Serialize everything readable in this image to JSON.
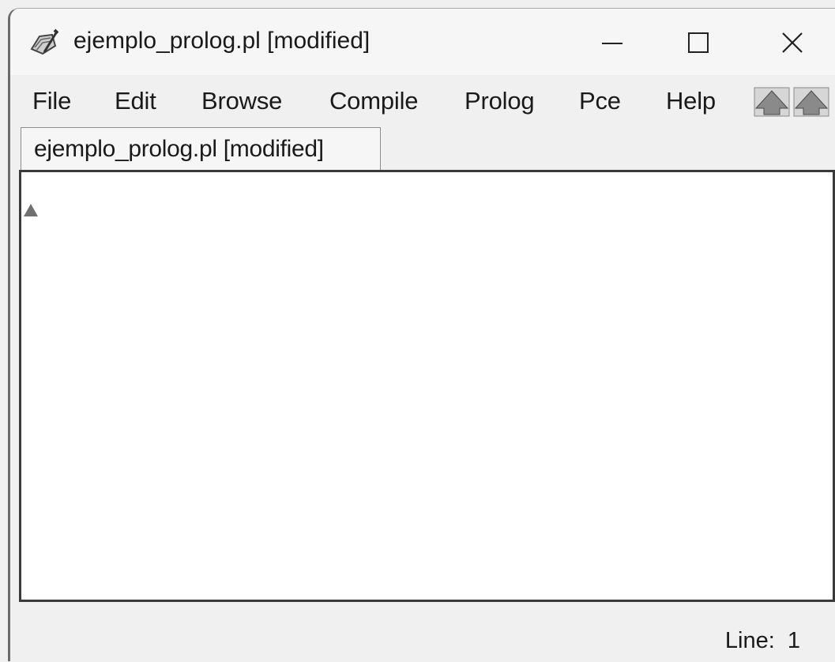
{
  "window": {
    "title": "ejemplo_prolog.pl [modified]",
    "icon": "pencil-paper-icon"
  },
  "window_controls": {
    "minimize_icon": "minimize-icon",
    "maximize_icon": "maximize-icon",
    "close_icon": "close-icon"
  },
  "menu": {
    "items": [
      {
        "label": "File"
      },
      {
        "label": "Edit"
      },
      {
        "label": "Browse"
      },
      {
        "label": "Compile"
      },
      {
        "label": "Prolog"
      },
      {
        "label": "Pce"
      },
      {
        "label": "Help"
      }
    ],
    "nav_icons": [
      "arrow-up-icon",
      "arrow-down-icon"
    ]
  },
  "tabs": [
    {
      "label": "ejemplo_prolog.pl [modified]",
      "active": true
    }
  ],
  "editor": {
    "content": "",
    "caret_marker": "caret-marker-icon"
  },
  "status": {
    "line_label": "Line:",
    "line_value": "1"
  }
}
